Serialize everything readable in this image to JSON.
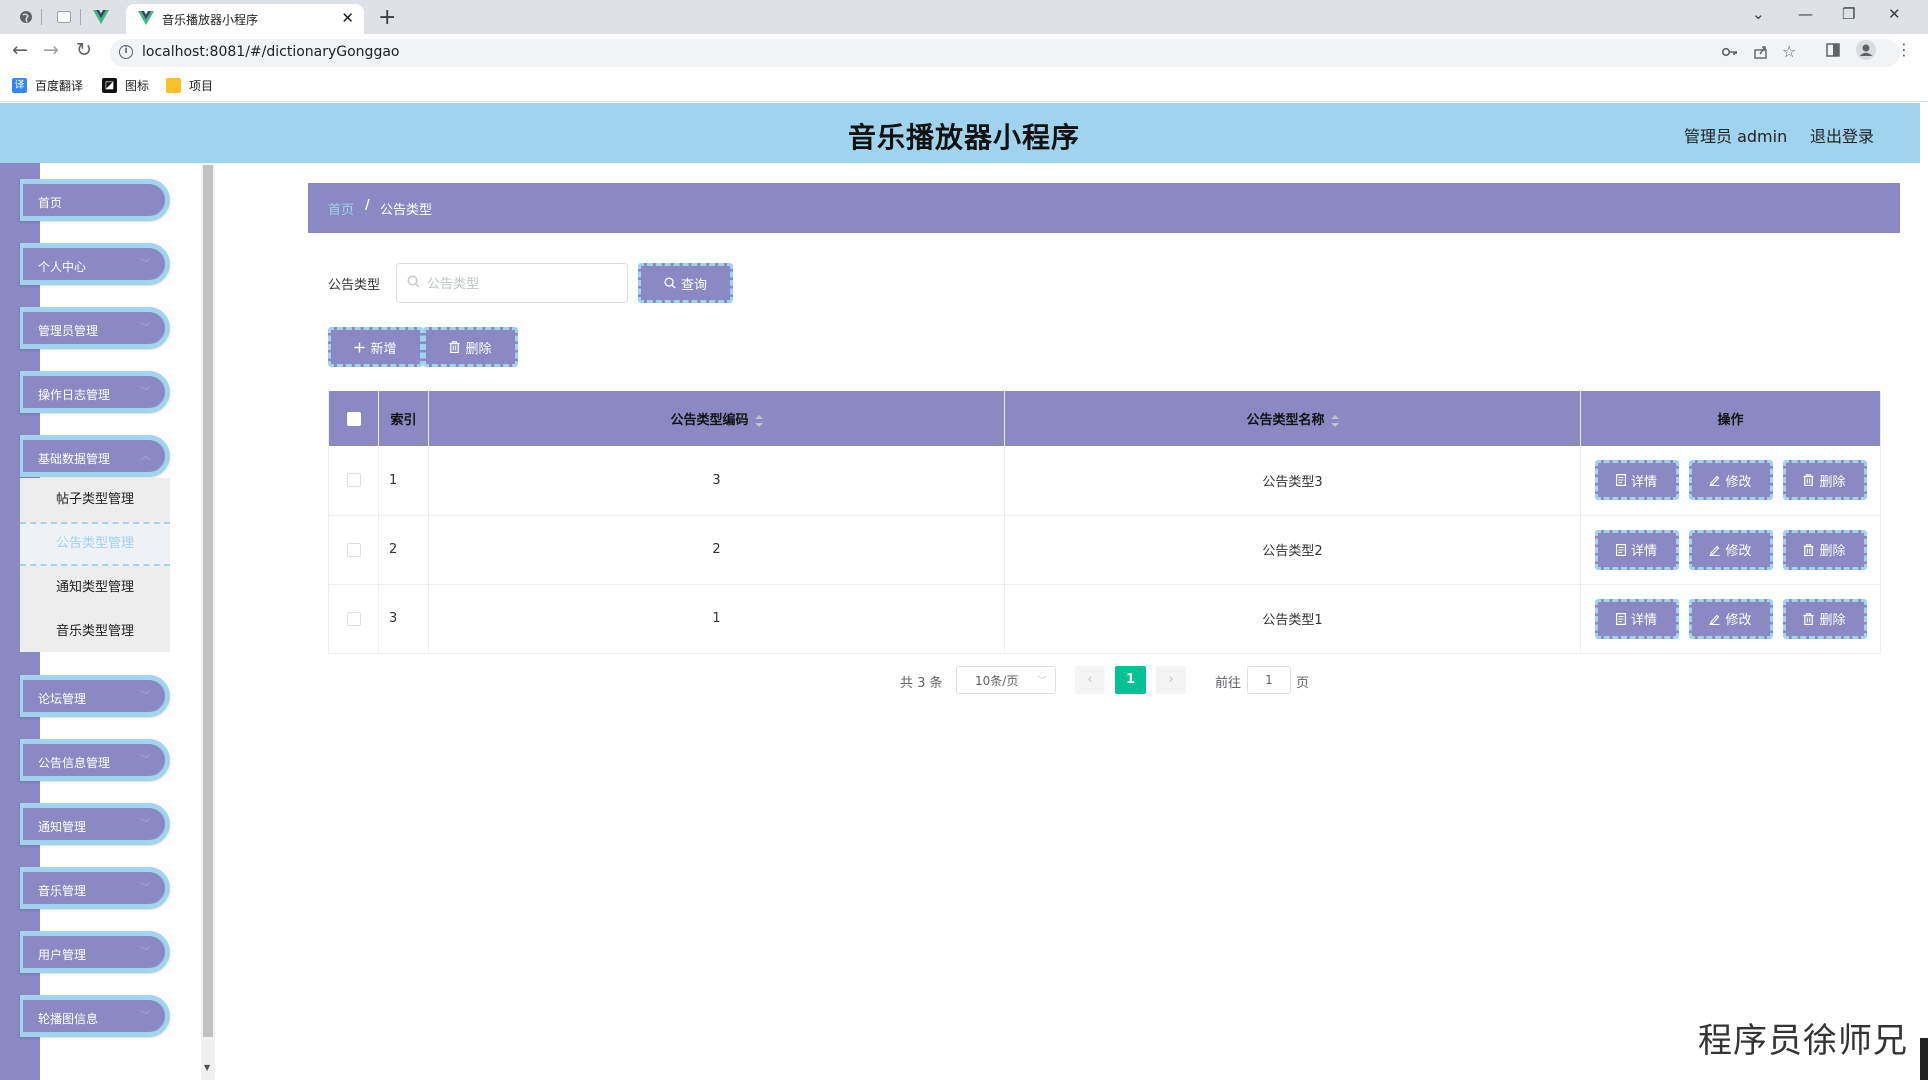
{
  "browser": {
    "tab_title": "音乐播放器小程序",
    "url": "localhost:8081/#/dictionaryGonggao",
    "bookmarks": [
      "百度翻译",
      "图标",
      "项目"
    ]
  },
  "header": {
    "title": "音乐播放器小程序",
    "user_label": "管理员 admin",
    "logout_label": "退出登录"
  },
  "sidebar": {
    "items": [
      {
        "label": "首页"
      },
      {
        "label": "个人中心"
      },
      {
        "label": "管理员管理"
      },
      {
        "label": "操作日志管理"
      },
      {
        "label": "基础数据管理"
      },
      {
        "label": "论坛管理"
      },
      {
        "label": "公告信息管理"
      },
      {
        "label": "通知管理"
      },
      {
        "label": "音乐管理"
      },
      {
        "label": "用户管理"
      },
      {
        "label": "轮播图信息"
      }
    ],
    "sub_items": [
      {
        "label": "帖子类型管理"
      },
      {
        "label": "公告类型管理"
      },
      {
        "label": "通知类型管理"
      },
      {
        "label": "音乐类型管理"
      }
    ]
  },
  "breadcrumb": {
    "home": "首页",
    "separator": "/",
    "current": "公告类型"
  },
  "search": {
    "label": "公告类型",
    "placeholder": "公告类型",
    "value": "",
    "button_label": "查询"
  },
  "actions": {
    "add_label": "新增",
    "delete_label": "删除"
  },
  "table": {
    "columns": [
      "索引",
      "公告类型编码",
      "公告类型名称",
      "操作"
    ],
    "rows": [
      {
        "index": "1",
        "code": "3",
        "name": "公告类型3"
      },
      {
        "index": "2",
        "code": "2",
        "name": "公告类型2"
      },
      {
        "index": "3",
        "code": "1",
        "name": "公告类型1"
      }
    ],
    "row_actions": {
      "detail": "详情",
      "edit": "修改",
      "delete": "删除"
    }
  },
  "pagination": {
    "total_text": "共 3 条",
    "page_size": "10条/页",
    "current_page": "1",
    "goto_label": "前往",
    "goto_value": "1",
    "page_suffix": "页"
  },
  "watermark": "程序员徐师兄",
  "colors": {
    "header_bg": "#a0d3ed",
    "accent_purple": "#8a89c3",
    "active_page": "#00c292"
  }
}
